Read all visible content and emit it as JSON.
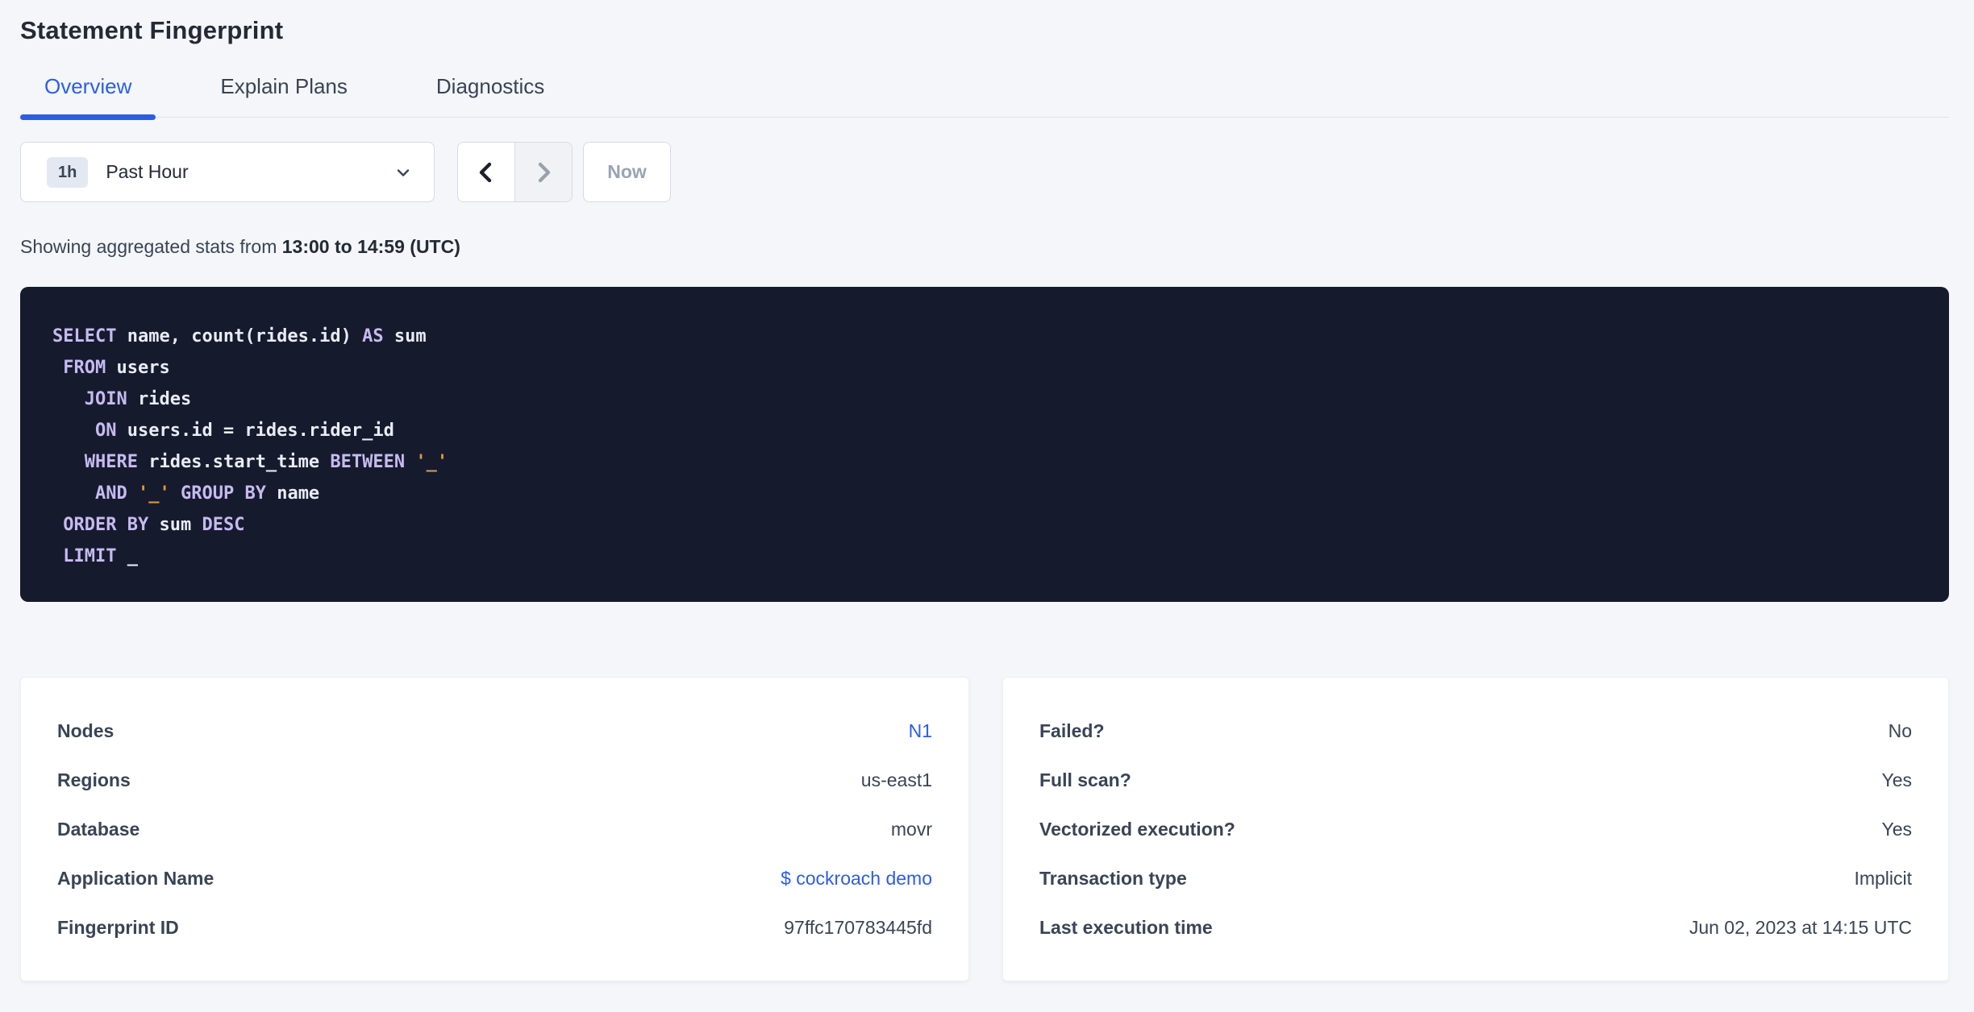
{
  "colors": {
    "accent": "#2b5fe3",
    "link": "#2b5ced",
    "page_bg": "#f4f6fa",
    "code_bg": "#151a2d",
    "code_keyword": "#c7baf0",
    "code_plain": "#e9ebf5",
    "code_string": "#e09a3a"
  },
  "header": {
    "title": "Statement Fingerprint"
  },
  "tabs": [
    {
      "label": "Overview",
      "active": true
    },
    {
      "label": "Explain Plans",
      "active": false
    },
    {
      "label": "Diagnostics",
      "active": false
    }
  ],
  "time_picker": {
    "badge": "1h",
    "selected": "Past Hour",
    "caret_icon": "chevron-down",
    "prev_icon": "chevron-left",
    "next_icon": "chevron-right",
    "prev_enabled": true,
    "next_enabled": false,
    "now_label": "Now"
  },
  "stats_line": {
    "prefix": "Showing aggregated stats from ",
    "range_bold": "13:00 to 14:59 (UTC)"
  },
  "sql": {
    "lines": [
      [
        {
          "t": "SELECT",
          "c": "kw"
        },
        {
          "t": " name, count(rides.id) ",
          "c": "id"
        },
        {
          "t": "AS",
          "c": "kw"
        },
        {
          "t": " sum",
          "c": "id"
        }
      ],
      [
        {
          "t": " ",
          "c": "id"
        },
        {
          "t": "FROM",
          "c": "kw"
        },
        {
          "t": " users",
          "c": "id"
        }
      ],
      [
        {
          "t": "   ",
          "c": "id"
        },
        {
          "t": "JOIN",
          "c": "kw"
        },
        {
          "t": " rides",
          "c": "id"
        }
      ],
      [
        {
          "t": "    ",
          "c": "id"
        },
        {
          "t": "ON",
          "c": "kw"
        },
        {
          "t": " users.id = rides.rider_id",
          "c": "id"
        }
      ],
      [
        {
          "t": "   ",
          "c": "id"
        },
        {
          "t": "WHERE",
          "c": "kw"
        },
        {
          "t": " rides.start_time ",
          "c": "id"
        },
        {
          "t": "BETWEEN",
          "c": "kw"
        },
        {
          "t": " ",
          "c": "id"
        },
        {
          "t": "'_'",
          "c": "str"
        }
      ],
      [
        {
          "t": "    ",
          "c": "id"
        },
        {
          "t": "AND",
          "c": "kw"
        },
        {
          "t": " ",
          "c": "id"
        },
        {
          "t": "'_'",
          "c": "str"
        },
        {
          "t": " ",
          "c": "id"
        },
        {
          "t": "GROUP BY",
          "c": "kw"
        },
        {
          "t": " name",
          "c": "id"
        }
      ],
      [
        {
          "t": " ",
          "c": "id"
        },
        {
          "t": "ORDER BY",
          "c": "kw"
        },
        {
          "t": " sum ",
          "c": "id"
        },
        {
          "t": "DESC",
          "c": "kw"
        }
      ],
      [
        {
          "t": " ",
          "c": "id"
        },
        {
          "t": "LIMIT",
          "c": "kw"
        },
        {
          "t": " _",
          "c": "id"
        }
      ]
    ]
  },
  "cards": {
    "left": {
      "rows": [
        {
          "label": "Nodes",
          "value": "N1",
          "link": true
        },
        {
          "label": "Regions",
          "value": "us-east1",
          "link": false
        },
        {
          "label": "Database",
          "value": "movr",
          "link": false
        },
        {
          "label": "Application Name",
          "value": "$ cockroach demo",
          "link": true
        },
        {
          "label": "Fingerprint ID",
          "value": "97ffc170783445fd",
          "link": false
        }
      ]
    },
    "right": {
      "rows": [
        {
          "label": "Failed?",
          "value": "No",
          "link": false
        },
        {
          "label": "Full scan?",
          "value": "Yes",
          "link": false
        },
        {
          "label": "Vectorized execution?",
          "value": "Yes",
          "link": false
        },
        {
          "label": "Transaction type",
          "value": "Implicit",
          "link": false
        },
        {
          "label": "Last execution time",
          "value": "Jun 02, 2023 at 14:15 UTC",
          "link": false
        }
      ]
    }
  }
}
